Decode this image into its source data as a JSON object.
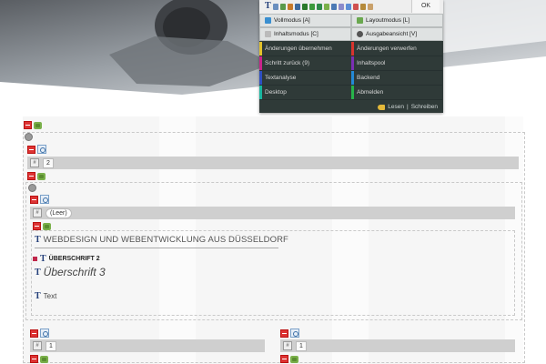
{
  "toolbar": {
    "ok_label": "OK"
  },
  "modes": {
    "vollmodus": "Vollmodus [A]",
    "layoutmodus": "Layoutmodus [L]",
    "inhaltsmodus": "Inhaltsmodus [C]",
    "ausgabeansicht": "Ausgabeansicht [V]"
  },
  "actions": [
    {
      "label": "Änderungen übernehmen",
      "color": "#e3c22b"
    },
    {
      "label": "Änderungen verwerfen",
      "color": "#d8342e"
    },
    {
      "label": "Schritt zurück (9)",
      "color": "#c9248b"
    },
    {
      "label": "Inhaltspool",
      "color": "#7b2fb3"
    },
    {
      "label": "Textanalyse",
      "color": "#2d4fc2"
    },
    {
      "label": "Backend",
      "color": "#2389d6"
    },
    {
      "label": "Desktop",
      "color": "#19b6a0"
    },
    {
      "label": "Abmelden",
      "color": "#27b44a"
    }
  ],
  "panel_footer": {
    "lesen": "Lesen",
    "separator": "|",
    "schreiben": "Schreiben"
  },
  "editor": {
    "value_2": "2",
    "leer": "(Leer)",
    "heading1": "WEBDESIGN UND WEBENTWICKLUNG AUS DÜSSELDORF",
    "heading2": "ÜBERSCHRIFT 2",
    "heading3": "Überschrift 3",
    "text": "Text",
    "value_1a": "1",
    "value_1b": "1",
    "t_glyph": "T"
  }
}
